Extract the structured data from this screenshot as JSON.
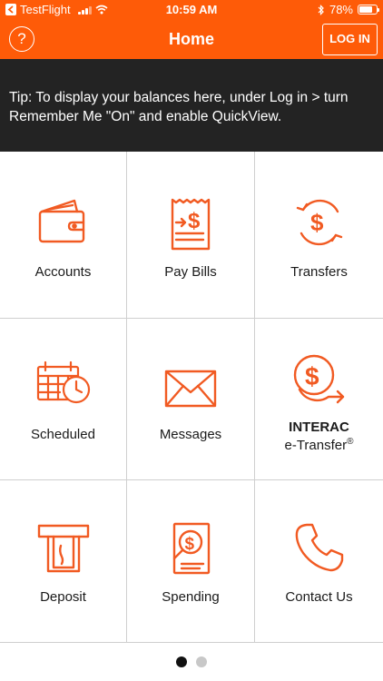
{
  "status_bar": {
    "carrier": "TestFlight",
    "time": "10:59 AM",
    "battery": "78%",
    "battery_level": 0.78,
    "icons": [
      "back-arrow-icon",
      "signal-icon",
      "wifi-icon",
      "bluetooth-icon",
      "battery-icon"
    ]
  },
  "nav": {
    "title": "Home",
    "help_symbol": "?",
    "login_label": "LOG IN"
  },
  "tip": {
    "text": "Tip: To display your balances here, under Log in > turn Remember Me \"On\" and enable QuickView."
  },
  "tiles": [
    {
      "label": "Accounts",
      "icon": "wallet-icon"
    },
    {
      "label": "Pay Bills",
      "icon": "bill-icon"
    },
    {
      "label": "Transfers",
      "icon": "transfer-icon"
    },
    {
      "label": "Scheduled",
      "icon": "calendar-clock-icon"
    },
    {
      "label": "Messages",
      "icon": "envelope-icon"
    },
    {
      "label_line1": "INTERAC",
      "label_line2": "e-Transfer",
      "label_mark": "®",
      "icon": "e-transfer-icon"
    },
    {
      "label": "Deposit",
      "icon": "atm-deposit-icon"
    },
    {
      "label": "Spending",
      "icon": "spending-report-icon"
    },
    {
      "label": "Contact Us",
      "icon": "phone-icon"
    }
  ],
  "pagination": {
    "pages": 2,
    "current": 1
  },
  "colors": {
    "brand_orange": "#fe5b08",
    "tip_background": "#232323",
    "icon_orange": "#f15a22",
    "grid_line": "#cfcfcf",
    "dot_active": "#111111",
    "dot_inactive": "#c8c8c8"
  }
}
